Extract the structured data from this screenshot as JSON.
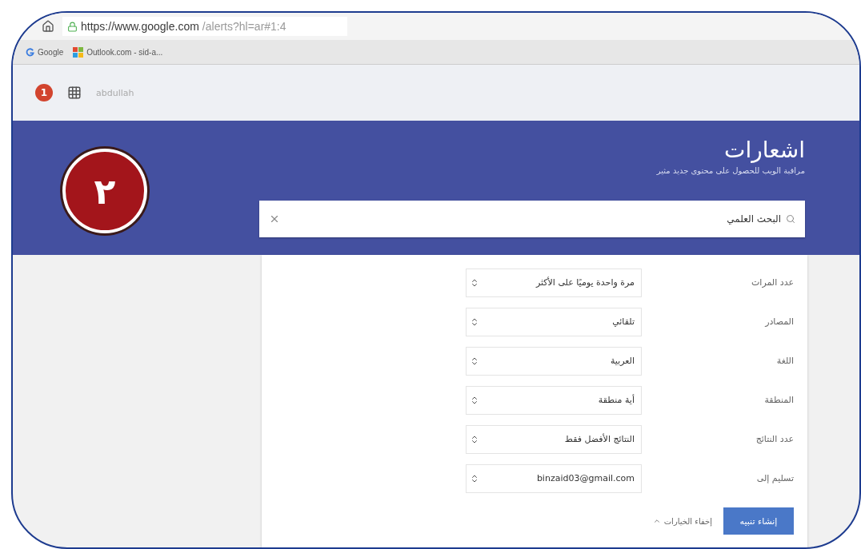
{
  "browser": {
    "url_host": "https://www.google.com",
    "url_path": "/alerts?hl=ar#1:4",
    "google_bookmark": "Google",
    "outlook_bookmark": "Outlook.com - sid-a..."
  },
  "account_bar": {
    "notifications": "1",
    "user": "abdullah"
  },
  "step_badge": "٢",
  "header": {
    "title": "اشعارات",
    "subtitle": "مراقبة الويب للحصول على محتوى جديد مثير"
  },
  "search": {
    "value": "البحث العلمي"
  },
  "options": [
    {
      "label": "عدد المرات",
      "value": "مرة واحدة يوميًا على الأكثر"
    },
    {
      "label": "المصادر",
      "value": "تلقائي"
    },
    {
      "label": "اللغة",
      "value": "العربية"
    },
    {
      "label": "المنطقة",
      "value": "أية منطقة"
    },
    {
      "label": "عدد النتائج",
      "value": "النتائج الأفضل فقط"
    },
    {
      "label": "تسليم إلى",
      "value": "binzaid03@gmail.com"
    }
  ],
  "create_button": "إنشاء تنبيه",
  "hide_options": "إخفاء الخيارات"
}
